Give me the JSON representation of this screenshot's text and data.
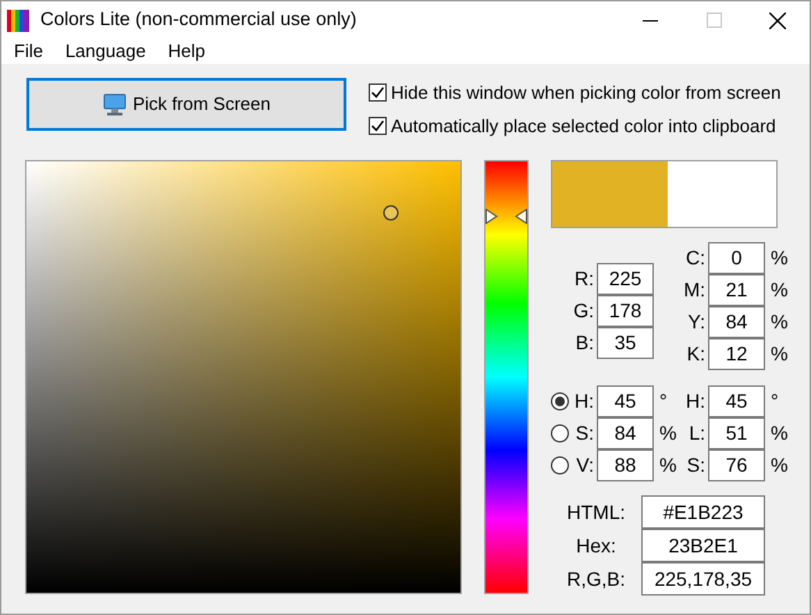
{
  "window": {
    "title": "Colors Lite (non-commercial use only)"
  },
  "menu": [
    "File",
    "Language",
    "Help"
  ],
  "pick_button": {
    "label": "Pick from Screen"
  },
  "options": [
    {
      "label": "Hide this window when picking color from screen",
      "checked": true
    },
    {
      "label": "Automatically place selected color into clipboard",
      "checked": true
    }
  ],
  "rgb": [
    {
      "label": "R:",
      "value": "225"
    },
    {
      "label": "G:",
      "value": "178"
    },
    {
      "label": "B:",
      "value": "35"
    }
  ],
  "cmyk": [
    {
      "label": "C:",
      "value": "0",
      "unit": "%"
    },
    {
      "label": "M:",
      "value": "21",
      "unit": "%"
    },
    {
      "label": "Y:",
      "value": "84",
      "unit": "%"
    },
    {
      "label": "K:",
      "value": "12",
      "unit": "%"
    }
  ],
  "hsv": [
    {
      "label": "H:",
      "value": "45",
      "unit": "°",
      "selected": true
    },
    {
      "label": "S:",
      "value": "84",
      "unit": "%",
      "selected": false
    },
    {
      "label": "V:",
      "value": "88",
      "unit": "%",
      "selected": false
    }
  ],
  "hsl": [
    {
      "label": "H:",
      "value": "45",
      "unit": "°"
    },
    {
      "label": "L:",
      "value": "51",
      "unit": "%"
    },
    {
      "label": "S:",
      "value": "76",
      "unit": "%"
    }
  ],
  "codes": [
    {
      "label": "HTML:",
      "value": "#E1B223"
    },
    {
      "label": "Hex:",
      "value": "23B2E1"
    },
    {
      "label": "R,G,B:",
      "value": "225,178,35"
    }
  ]
}
